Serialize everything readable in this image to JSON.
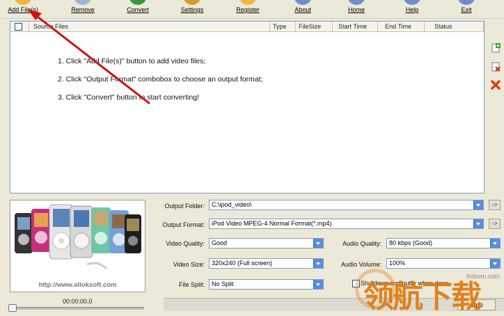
{
  "toolbar": {
    "items": [
      {
        "label": "Add File(s)",
        "icon": "add-files-icon",
        "color": "#e8b840"
      },
      {
        "label": "Remove",
        "icon": "remove-icon",
        "color": "#9bb6d8"
      },
      {
        "label": "Convert",
        "icon": "convert-icon",
        "color": "#3a9a3a"
      },
      {
        "label": "Settings",
        "icon": "settings-icon",
        "color": "#d89a30"
      },
      {
        "label": "Register",
        "icon": "register-icon",
        "color": "#e8b840"
      },
      {
        "label": "About",
        "icon": "about-icon",
        "color": "#6a8ed0"
      },
      {
        "label": "Home",
        "icon": "home-icon",
        "color": "#6a8ed0"
      },
      {
        "label": "Help",
        "icon": "help-icon",
        "color": "#6a8ed0"
      },
      {
        "label": "Exit",
        "icon": "exit-icon",
        "color": "#6a8ed0"
      }
    ]
  },
  "file_list": {
    "columns": [
      "Source Files",
      "Type",
      "FileSize",
      "Start Time",
      "End Time",
      "Status"
    ],
    "instructions": [
      "1. Click \"Add File(s)\" button to add video files;",
      "2. Click \"Output Format\" combobox to choose an output format;",
      "3. Click \"Convert\" button to start converting!"
    ]
  },
  "side_buttons": [
    "add-list-icon",
    "remove-list-icon",
    "clear-list-icon"
  ],
  "preview": {
    "url": "http://www.alloksoft.com",
    "time": "00:00:00.0"
  },
  "settings": {
    "output_folder_label": "Output Folder:",
    "output_folder_value": "C:\\ipod_video\\",
    "output_format_label": "Output Format:",
    "output_format_value": "iPod Video MPEG-4 Normal Format(*.mp4)",
    "video_quality_label": "Video Quality:",
    "video_quality_value": "Good",
    "audio_quality_label": "Audio Quality:",
    "audio_quality_value": "80  kbps (Good)",
    "video_size_label": "Video Size:",
    "video_size_value": "320x240    (Full screen)",
    "audio_volume_label": "Audio Volume:",
    "audio_volume_value": "100%",
    "file_split_label": "File Split:",
    "file_split_value": "No Split",
    "shutdown_label": "Shutdown computer when done",
    "browse_arrow": "->"
  },
  "progress": {
    "stop_label": "Stop"
  },
  "watermark": {
    "text": "领航下载",
    "url": "lhdown.com"
  },
  "colors": {
    "accent": "#5a8de0",
    "annotation_arrow": "#cc1010"
  }
}
